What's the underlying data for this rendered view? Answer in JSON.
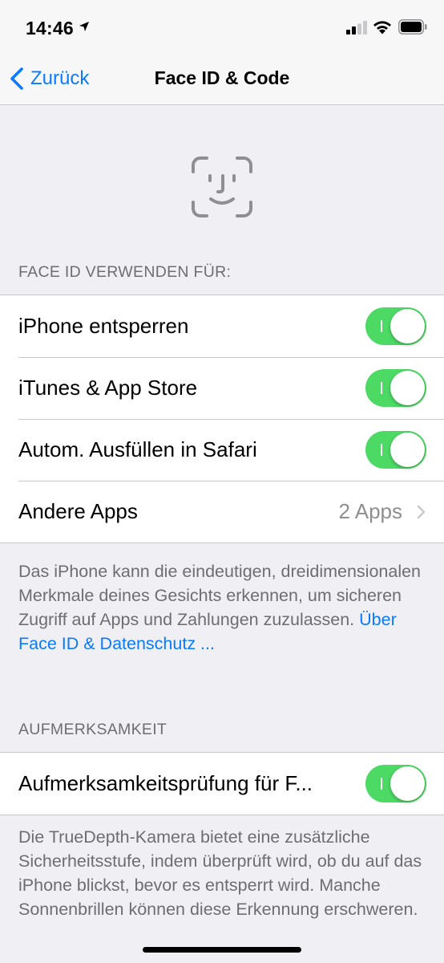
{
  "status_bar": {
    "time": "14:46",
    "location_icon": "location-arrow-icon",
    "signal_icon": "cellular-signal-icon",
    "wifi_icon": "wifi-icon",
    "battery_icon": "battery-icon"
  },
  "nav": {
    "back_label": "Zurück",
    "title": "Face ID & Code"
  },
  "face_id_icon": "face-id-icon",
  "section_use": {
    "header": "FACE ID VERWENDEN FÜR:",
    "rows": [
      {
        "label": "iPhone entsperren",
        "enabled": true
      },
      {
        "label": "iTunes & App Store",
        "enabled": true
      },
      {
        "label": "Autom. Ausfüllen in Safari",
        "enabled": true
      }
    ],
    "other_apps": {
      "label": "Andere Apps",
      "value": "2 Apps"
    },
    "footer": "Das iPhone kann die eindeutigen, dreidimensionalen Merkmale deines Gesichts erkennen, um sicheren Zugriff auf Apps und Zahlungen zuzulassen.",
    "footer_link": "Über Face ID & Datenschutz ..."
  },
  "section_attention": {
    "header": "AUFMERKSAMKEIT",
    "row": {
      "label": "Aufmerksamkeitsprüfung für F...",
      "enabled": true
    },
    "footer": "Die TrueDepth-Kamera bietet eine zusätzliche Sicherheitsstufe, indem überprüft wird, ob du auf das iPhone blickst, bevor es entsperrt wird. Manche Sonnenbrillen können diese Erkennung erschweren."
  },
  "colors": {
    "accent": "#0a7aff",
    "toggle_on": "#4cd964",
    "background": "#efeff4"
  }
}
